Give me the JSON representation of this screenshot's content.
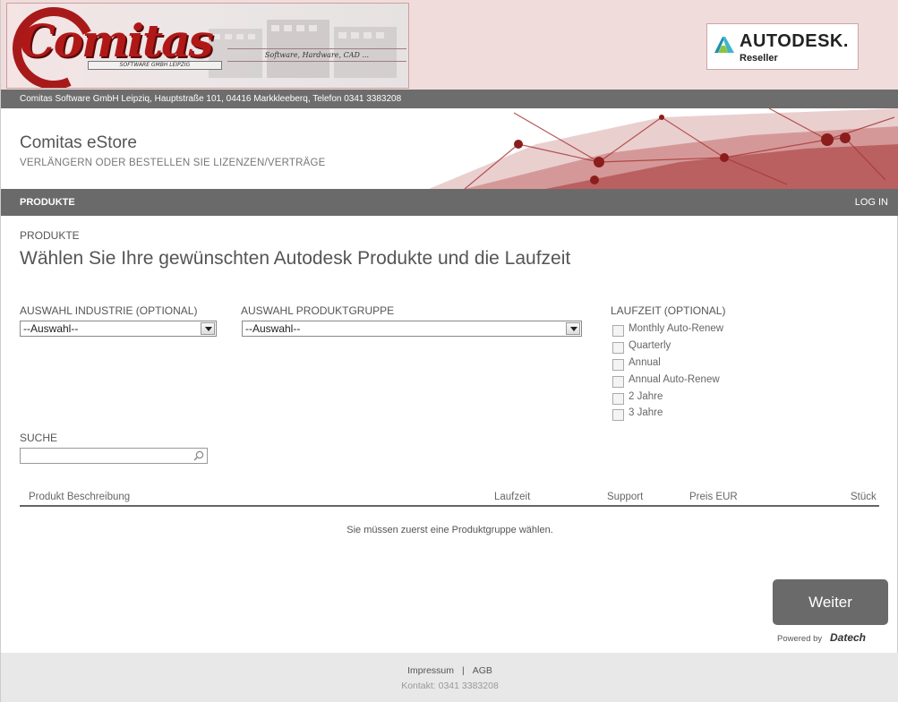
{
  "header": {
    "logo_text": "Comitas",
    "logo_subtitle": "SOFTWARE GMBH LEIPZIG",
    "logo_tagline": "Software, Hardware, CAD ...",
    "partner_name": "AUTODESK.",
    "partner_level": "Reseller",
    "address": "Comitas Software GmbH Leipziq, Hauptstraße 101, 04416 Markkleeberq, Telefon 0341 3383208"
  },
  "hero": {
    "title": "Comitas eStore",
    "subtitle": "VERLÄNGERN ODER BESTELLEN SIE LIZENZEN/VERTRÄGE"
  },
  "nav": {
    "products": "PRODUKTE",
    "login": "LOG IN"
  },
  "main": {
    "section_label": "PRODUKTE",
    "heading": "Wählen Sie Ihre gewünschten Autodesk Produkte und die Laufzeit",
    "industry": {
      "label": "AUSWAHL INDUSTRIE (OPTIONAL)",
      "value": "--Auswahl--"
    },
    "product_group": {
      "label": "AUSWAHL PRODUKTGRUPPE",
      "value": "--Auswahl--"
    },
    "term": {
      "label": "LAUFZEIT (OPTIONAL)",
      "options": [
        "Monthly Auto-Renew",
        "Quarterly",
        "Annual",
        "Annual Auto-Renew",
        "2 Jahre",
        "3 Jahre"
      ]
    },
    "search": {
      "label": "SUCHE",
      "value": ""
    },
    "table": {
      "columns": [
        "Produkt Beschreibung",
        "Laufzeit",
        "Support",
        "Preis EUR",
        "Stück"
      ],
      "empty_message": "Sie müssen zuerst eine Produktgruppe wählen."
    },
    "next_button": "Weiter",
    "powered_by": "Powered by",
    "powered_brand": "Datech"
  },
  "footer": {
    "impressum": "Impressum",
    "separator": "|",
    "agb": "AGB",
    "contact": "Kontakt: 0341 3383208"
  },
  "colors": {
    "brand_red": "#b01818",
    "bar_gray": "#6a6a6a",
    "banner_pink": "#f1dcdc"
  }
}
